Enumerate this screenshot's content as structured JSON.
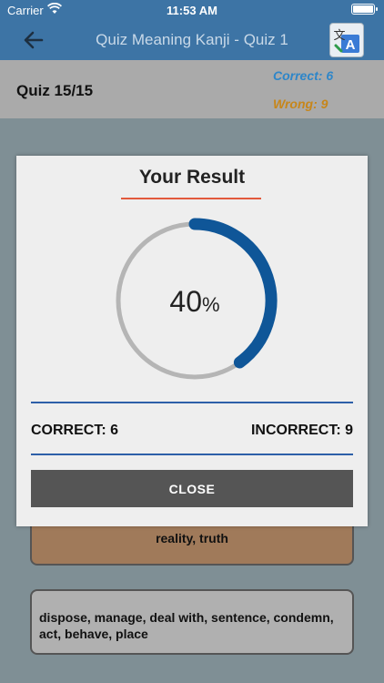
{
  "status_bar": {
    "carrier": "Carrier",
    "time": "11:53 AM"
  },
  "nav": {
    "title": "Quiz Meaning Kanji - Quiz 1",
    "back_icon": "arrow-left-icon",
    "translate_icon": "translate-icon"
  },
  "quiz_header": {
    "progress": "Quiz 15/15",
    "correct": "Correct: 6",
    "wrong": "Wrong: 9"
  },
  "options": [
    {
      "text": "reality, truth"
    },
    {
      "text": "dispose, manage, deal with, sentence, condemn, act, behave, place"
    }
  ],
  "result": {
    "title": "Your Result",
    "percent_value": "40",
    "percent_unit": "%",
    "progress": 0.4,
    "correct_text": "CORRECT: 6",
    "incorrect_text": "INCORRECT: 9",
    "close_label": "CLOSE"
  },
  "colors": {
    "nav": "#3d74a5",
    "ring_progress": "#0f5698",
    "ring_track": "#b5b5b5",
    "accent_line": "#e2593c",
    "correct": "#2e86c9",
    "wrong": "#c7861a"
  }
}
